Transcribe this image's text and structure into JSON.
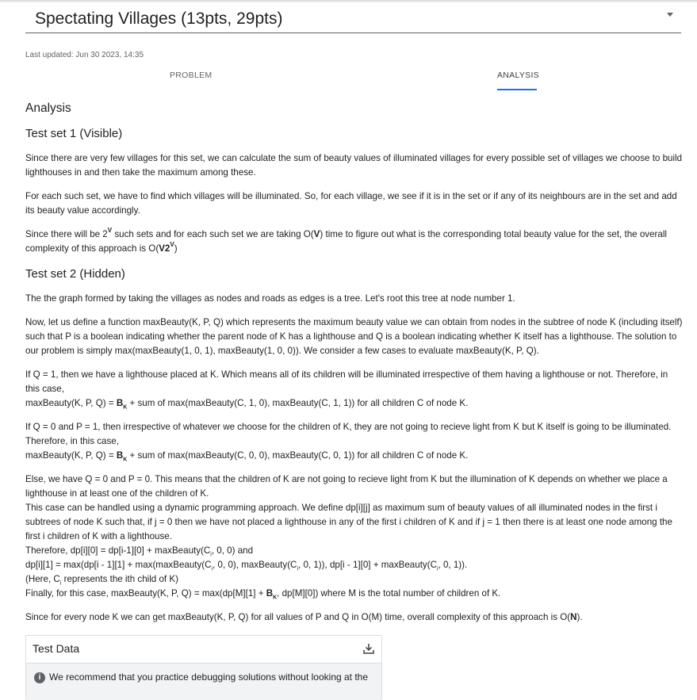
{
  "header": {
    "title": "Spectating Villages (13pts, 29pts)",
    "last_updated": "Last updated: Jun 30 2023, 14:35"
  },
  "tabs": [
    {
      "label": "PROBLEM",
      "active": false
    },
    {
      "label": "ANALYSIS",
      "active": true
    }
  ],
  "analysis": {
    "heading": "Analysis",
    "set1_heading": "Test set 1 (Visible)",
    "p1": "Since there are very few villages for this set, we can calculate the sum of beauty values of illuminated villages for every possible set of villages we choose to build lighthouses in and then take the maximum among these.",
    "p2": "For each such set, we have to find which villages will be illuminated. So, for each village, we see if it is in the set or if any of its neighbours are in the set and add its beauty value accordingly.",
    "p3a": "Since there will be 2",
    "p3b": "V",
    "p3c": " such sets and for each such set we are taking O(",
    "p3d": "V",
    "p3e": ") time to figure out what is the corresponding total beauty value for the set, the overall complexity of this approach is O(",
    "p3f": "V2",
    "p3g": "V",
    "p3h": ")",
    "set2_heading": "Test set 2 (Hidden)",
    "p4": "The the graph formed by taking the villages as nodes and roads as edges is a tree. Let's root this tree at node number 1.",
    "p5": "Now, let us define a function maxBeauty(K, P, Q) which represents the maximum beauty value we can obtain from nodes in the subtree of node K (including itself) such that P is a boolean indicating whether the parent node of K has a lighthouse and Q is a boolean indicating whether K itself has a lighthouse. The solution to our problem is simply max(maxBeauty(1, 0, 1), maxBeauty(1, 0, 0)). We consider a few cases to evaluate maxBeauty(K, P, Q).",
    "p6a": "If Q = 1, then we have a lighthouse placed at K. Which means all of its children will be illuminated irrespective of them having a lighthouse or not. Therefore, in this case,",
    "p6b1": "maxBeauty(K, P, Q) = ",
    "p6b2": "B",
    "p6b3": "K",
    "p6b4": " + sum of max(maxBeauty(C, 1, 0), maxBeauty(C, 1, 1)) for all children C of node K.",
    "p7a": "If Q = 0 and P = 1, then irrespective of whatever we choose for the children of K, they are not going to recieve light from K but K itself is going to be illuminated. Therefore, in this case,",
    "p7b1": "maxBeauty(K, P, Q) = ",
    "p7b2": "B",
    "p7b3": "K",
    "p7b4": " + sum of max(maxBeauty(C, 0, 0), maxBeauty(C, 0, 1)) for all children C of node K.",
    "p8a": "Else, we have Q = 0 and P = 0. This means that the children of K are not going to recieve light from K but the illumination of K depends on whether we place a lighthouse in at least one of the children of K.",
    "p8b": "This case can be handled using a dynamic programming approach. We define dp[i][j] as maximum sum of beauty values of all illuminated nodes in the first i subtrees of node K such that, if j = 0 then we have not placed a lighthouse in any of the first i children of K and if j = 1 then there is at least one node among the first i children of K with a lighthouse.",
    "p8c": "Therefore, dp[i][0] = dp[i-1][0] + maxBeauty(C",
    "p8c_sub": "i",
    "p8c_end": ", 0, 0) and",
    "p8d1": "dp[i][1] = max(dp[i - 1][1] + max(maxBeauty(C",
    "p8d_sub1": "i",
    "p8d2": ", 0, 0), maxBeauty(C",
    "p8d_sub2": "i",
    "p8d3": ", 0, 1)), dp[i - 1][0] + maxBeauty(C",
    "p8d_sub3": "i",
    "p8d4": ", 0, 1)).",
    "p8e1": "(Here, C",
    "p8e_sub": "i",
    "p8e2": " represents the ith child of K)",
    "p8f1": "Finally, for this case, maxBeauty(K, P, Q) = max(dp[M][1] + ",
    "p8f2": "B",
    "p8f3": "K",
    "p8f4": ", dp[M][0]) where M is the total number of children of K.",
    "p9a": "Since for every node K we can get maxBeauty(K, P, Q) for all values of P and Q in O(M) time, overall complexity of this approach is O(",
    "p9b": "N",
    "p9c": ")."
  },
  "test_data": {
    "title": "Test Data",
    "note": "We recommend that you practice debugging solutions without looking at the",
    "download_icon": "download-icon",
    "info_icon": "info-icon"
  }
}
